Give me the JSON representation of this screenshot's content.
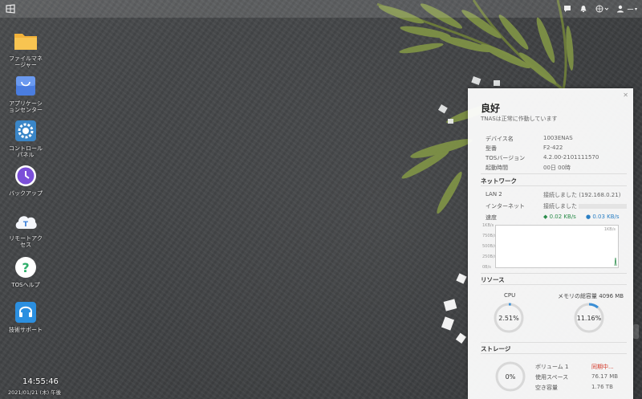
{
  "topbar": {
    "user_label": "ー"
  },
  "desktop": {
    "icons": [
      {
        "label": "ファイルマネージャー"
      },
      {
        "label": "アプリケーションセンター"
      },
      {
        "label": "コントロールパネル"
      },
      {
        "label": "バックアップ"
      },
      {
        "label": "リモートアクセス"
      },
      {
        "label": "TOSヘルプ"
      },
      {
        "label": "技術サポート"
      }
    ],
    "clock": {
      "time": "14:55:46",
      "date": "2021/01/21 (木) 午後"
    }
  },
  "panel": {
    "status_title": "良好",
    "status_sub": "TNASは正常に作動しています",
    "info": [
      {
        "key": "デバイス名",
        "value": "1003ENAS"
      },
      {
        "key": "型番",
        "value": "F2-422"
      },
      {
        "key": "TOSバージョン",
        "value": "4.2.00-2101111570"
      },
      {
        "key": "起動時間",
        "value": "00日 00時"
      }
    ],
    "network": {
      "title": "ネットワーク",
      "rows": [
        {
          "key": "LAN 2",
          "value": "接続しました (192.168.0.21)"
        },
        {
          "key": "インターネット",
          "value": "接続しました"
        },
        {
          "key": "速度",
          "value": ""
        }
      ],
      "upload": "0.02 KB/s",
      "download": "0.03 KB/s",
      "graph_top_label": "1KB/s",
      "graph_y_labels": [
        "1KB/s",
        "750B/s",
        "500B/s",
        "250B/s",
        "0B/s"
      ]
    },
    "resources": {
      "title": "リソース",
      "cpu_label": "CPU",
      "cpu_value": "2.51%",
      "cpu_fraction": 0.0251,
      "mem_label": "メモリの総容量 4096 MB",
      "mem_value": "11.16%",
      "mem_fraction": 0.1116
    },
    "storage": {
      "title": "ストレージ",
      "gauge_value": "0%",
      "rows": [
        {
          "key": "ボリューム 1",
          "value": "同期中..."
        },
        {
          "key": "使用スペース",
          "value": "76.17 MB"
        },
        {
          "key": "空き容量",
          "value": "1.76 TB"
        }
      ]
    }
  },
  "colors": {
    "upload": "#2a8c4a",
    "download": "#2a7fc4",
    "gauge": "#3b8fd6",
    "alert": "#d43a2a"
  }
}
